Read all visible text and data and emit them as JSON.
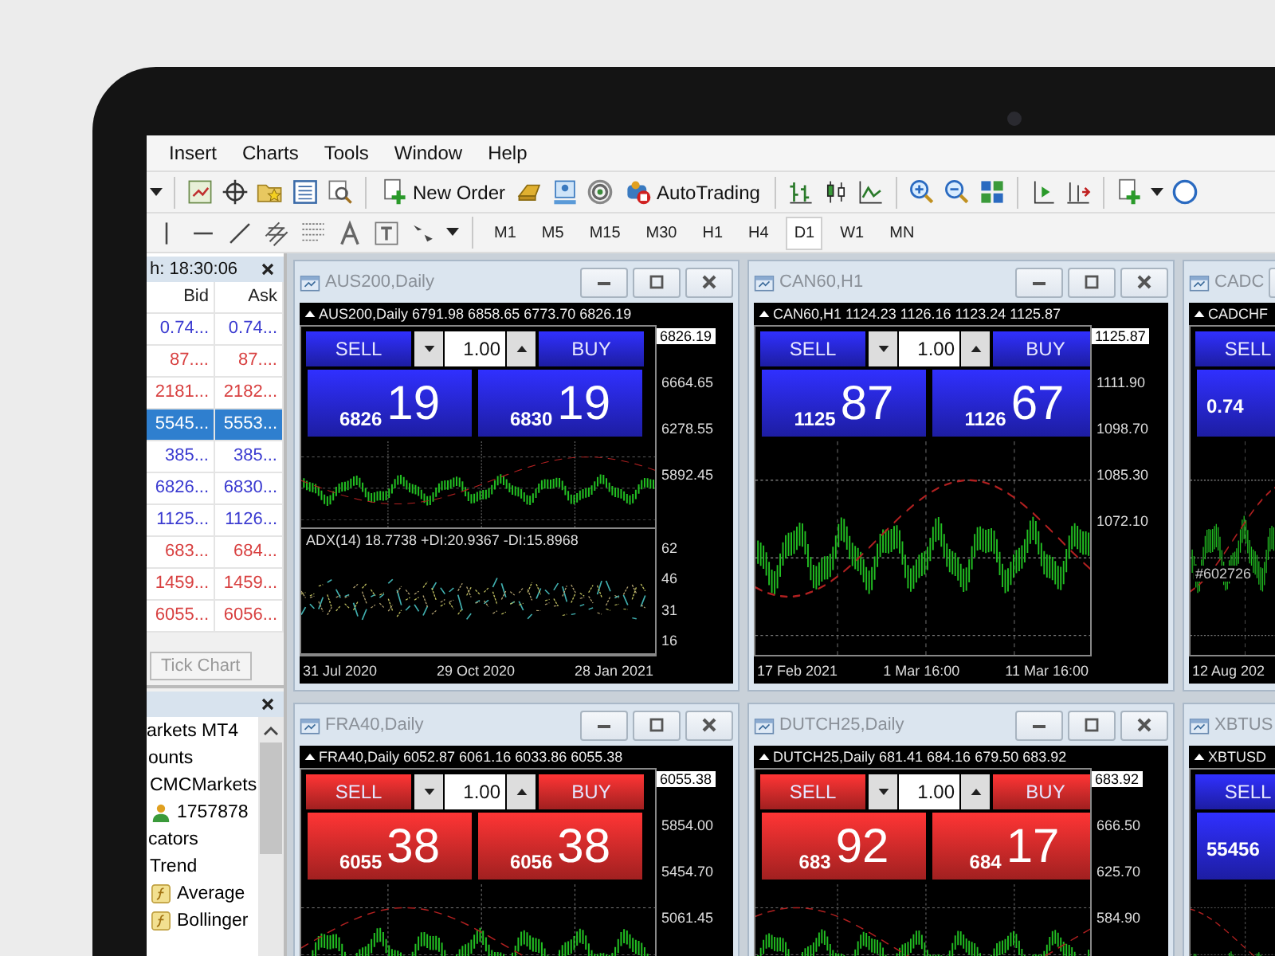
{
  "menu": [
    "Insert",
    "Charts",
    "Tools",
    "Window",
    "Help"
  ],
  "toolbar": {
    "new_order": "New Order",
    "auto_trading": "AutoTrading"
  },
  "timeframes": [
    {
      "label": "M1",
      "selected": false
    },
    {
      "label": "M5",
      "selected": false
    },
    {
      "label": "M15",
      "selected": false
    },
    {
      "label": "M30",
      "selected": false
    },
    {
      "label": "H1",
      "selected": false
    },
    {
      "label": "H4",
      "selected": false
    },
    {
      "label": "D1",
      "selected": true
    },
    {
      "label": "W1",
      "selected": false
    },
    {
      "label": "MN",
      "selected": false
    }
  ],
  "market_watch": {
    "title": "h: 18:30:06",
    "columns": [
      "Bid",
      "Ask"
    ],
    "rows": [
      {
        "bid": "0.74...",
        "ask": "0.74...",
        "color": "#3a3ad0",
        "selected": false
      },
      {
        "bid": "87....",
        "ask": "87....",
        "color": "#d84040",
        "selected": false
      },
      {
        "bid": "2181...",
        "ask": "2182...",
        "color": "#d84040",
        "selected": false
      },
      {
        "bid": "5545...",
        "ask": "5553...",
        "selected": true
      },
      {
        "bid": "385...",
        "ask": "385...",
        "color": "#3a3ad0",
        "selected": false
      },
      {
        "bid": "6826...",
        "ask": "6830...",
        "color": "#3a3ad0",
        "selected": false
      },
      {
        "bid": "1125...",
        "ask": "1126...",
        "color": "#3a3ad0",
        "selected": false
      },
      {
        "bid": "683...",
        "ask": "684...",
        "color": "#d84040",
        "selected": false
      },
      {
        "bid": "1459...",
        "ask": "1459...",
        "color": "#d84040",
        "selected": false
      },
      {
        "bid": "6055...",
        "ask": "6056...",
        "color": "#d84040",
        "selected": false
      }
    ],
    "tab": "Tick Chart"
  },
  "navigator": {
    "items": [
      {
        "label": "arkets MT4",
        "children": [
          {
            "label": "ounts",
            "children": [
              {
                "label": "CMCMarkets",
                "children": [
                  {
                    "label": "1757878",
                    "kind": "account"
                  }
                ]
              }
            ]
          },
          {
            "label": "cators",
            "children": [
              {
                "label": "Trend",
                "children": [
                  {
                    "label": "Average",
                    "kind": "indicator"
                  },
                  {
                    "label": "Bollinger",
                    "kind": "indicator"
                  }
                ]
              }
            ]
          }
        ]
      }
    ]
  },
  "charts": [
    {
      "title": "AUS200,Daily",
      "header": "AUS200,Daily  6791.98 6858.65 6773.70 6826.19",
      "color": "#2626d8",
      "sell_label": "SELL",
      "lot": "1.00",
      "buy_label": "BUY",
      "sell_small": "6826",
      "sell_big": "19",
      "buy_small": "6830",
      "buy_big": "19",
      "price_tag": "6826.19",
      "price_labels": [
        "6664.65",
        "6278.55",
        "5892.45"
      ],
      "indicator": {
        "text": "ADX(14) 18.7738 +DI:20.9367 -DI:15.8968",
        "labels": [
          "62",
          "46",
          "31",
          "16"
        ]
      },
      "dates": [
        "31 Jul 2020",
        "29 Oct 2020",
        "28 Jan 2021"
      ]
    },
    {
      "title": "CAN60,H1",
      "header": "CAN60,H1  1124.23 1126.16 1123.24 1125.87",
      "color": "#2626d8",
      "sell_label": "SELL",
      "lot": "1.00",
      "buy_label": "BUY",
      "sell_small": "1125",
      "sell_big": "87",
      "buy_small": "1126",
      "buy_big": "67",
      "price_tag": "1125.87",
      "price_labels": [
        "1111.90",
        "1098.70",
        "1085.30",
        "1072.10"
      ],
      "dates": [
        "17 Feb 2021",
        "1 Mar 16:00",
        "11 Mar 16:00"
      ]
    },
    {
      "title": "CADC",
      "header": "CADCHF",
      "color": "#2626d8",
      "sell_label": "SELL",
      "sell_small": "0.74",
      "annotation": "#602726",
      "dates": [
        "12 Aug 202"
      ]
    },
    {
      "title": "FRA40,Daily",
      "header": "FRA40,Daily  6052.87 6061.16 6033.86 6055.38",
      "color": "#d62a2a",
      "sell_label": "SELL",
      "lot": "1.00",
      "buy_label": "BUY",
      "sell_small": "6055",
      "sell_big": "38",
      "buy_small": "6056",
      "buy_big": "38",
      "price_tag": "6055.38",
      "price_labels": [
        "5854.00",
        "5454.70",
        "5061.45"
      ]
    },
    {
      "title": "DUTCH25,Daily",
      "header": "DUTCH25,Daily  681.41 684.16 679.50 683.92",
      "color": "#d62a2a",
      "sell_label": "SELL",
      "lot": "1.00",
      "buy_label": "BUY",
      "sell_small": "683",
      "sell_big": "92",
      "buy_small": "684",
      "buy_big": "17",
      "price_tag": "683.92",
      "price_labels": [
        "666.50",
        "625.70",
        "584.90"
      ]
    },
    {
      "title": "XBTUS",
      "header": "XBTUSD",
      "color": "#2626d8",
      "sell_label": "SELL",
      "sell_small": "55456"
    }
  ]
}
